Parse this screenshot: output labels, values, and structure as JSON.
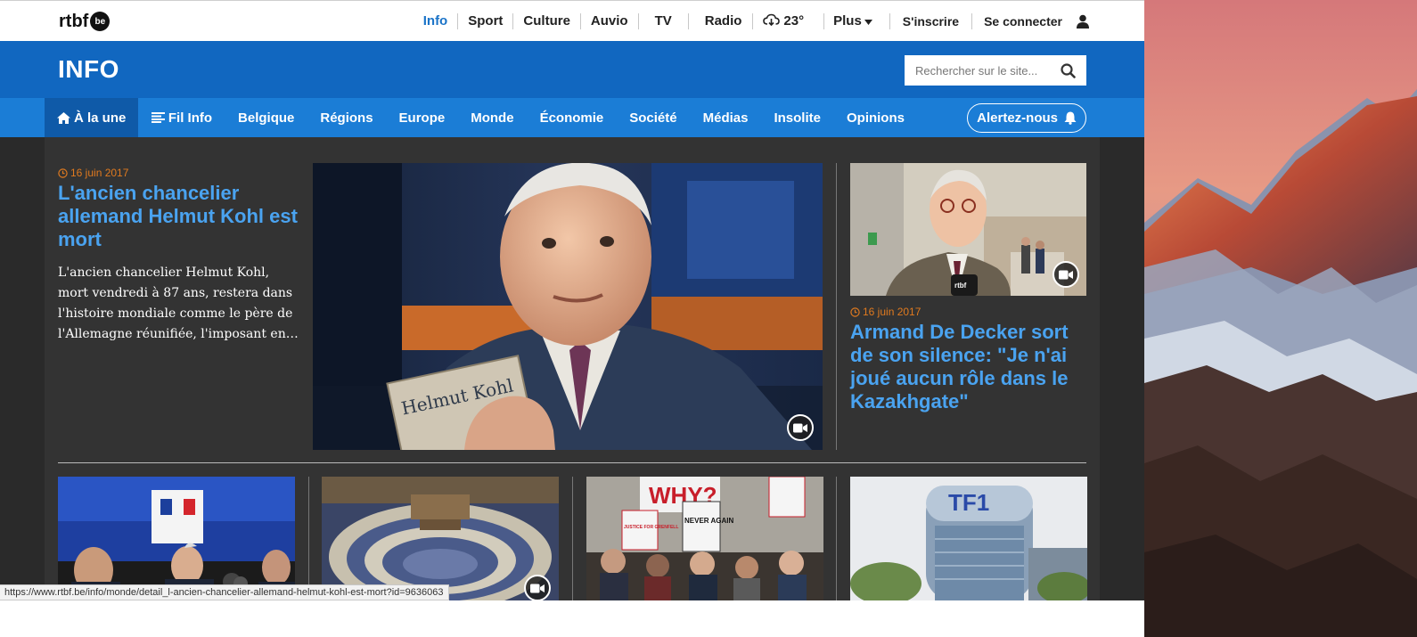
{
  "brand": {
    "logo_text": "rtbf",
    "logo_badge": "be",
    "section_title": "INFO"
  },
  "topnav": [
    {
      "label": "Info",
      "active": true
    },
    {
      "label": "Sport"
    },
    {
      "label": "Culture"
    },
    {
      "label": "Auvio"
    },
    {
      "label": "TV"
    },
    {
      "label": "Radio"
    },
    {
      "label": "23°",
      "icon": "weather-cloud-icon"
    },
    {
      "label": "Plus",
      "icon": "caret-down-icon"
    },
    {
      "label": "S'inscrire"
    },
    {
      "label": "Se connecter",
      "icon": "user-icon"
    }
  ],
  "search": {
    "placeholder": "Rechercher sur le site..."
  },
  "sections": [
    {
      "label": "À la une",
      "active": true,
      "icon": "home-icon"
    },
    {
      "label": "Fil Info",
      "icon": "list-icon"
    },
    {
      "label": "Belgique"
    },
    {
      "label": "Régions"
    },
    {
      "label": "Europe"
    },
    {
      "label": "Monde"
    },
    {
      "label": "Économie"
    },
    {
      "label": "Société"
    },
    {
      "label": "Médias"
    },
    {
      "label": "Insolite"
    },
    {
      "label": "Opinions"
    }
  ],
  "alert_button": {
    "label": "Alertez-nous",
    "icon": "bell-icon"
  },
  "lead_article": {
    "date": "16 juin 2017",
    "title": "L'ancien chancelier allemand Helmut Kohl est mort",
    "summary": "L'ancien chancelier Helmut Kohl, mort vendredi à 87 ans, restera dans l'histoire mondiale comme le père de l'Allemagne réunifiée, l'imposant en…",
    "photo_book_text": "Helmut Kohl"
  },
  "side_article": {
    "date": "16 juin 2017",
    "title": "Armand De Decker sort de son silence: \"Je n'ai joué aucun rôle dans le Kazakhgate\"",
    "mic_text": "rtbf"
  },
  "thumbnails": [
    {
      "name": "press-conference"
    },
    {
      "name": "parliament-hemicycle"
    },
    {
      "name": "grenfell-protest",
      "signs": [
        "WHY?",
        "NEVER AGAIN",
        "JUSTICE FOR GRENFELL"
      ]
    },
    {
      "name": "tf1-tower",
      "building_text": "TF1"
    }
  ],
  "status_url": "https://www.rtbf.be/info/monde/detail_l-ancien-chancelier-allemand-helmut-kohl-est-mort?id=9636063",
  "colors": {
    "brand_blue": "#1167c0",
    "nav_blue": "#1b7dd6",
    "link_blue": "#4aa3f0",
    "date_orange": "#e07a1f",
    "content_bg": "#333333"
  }
}
